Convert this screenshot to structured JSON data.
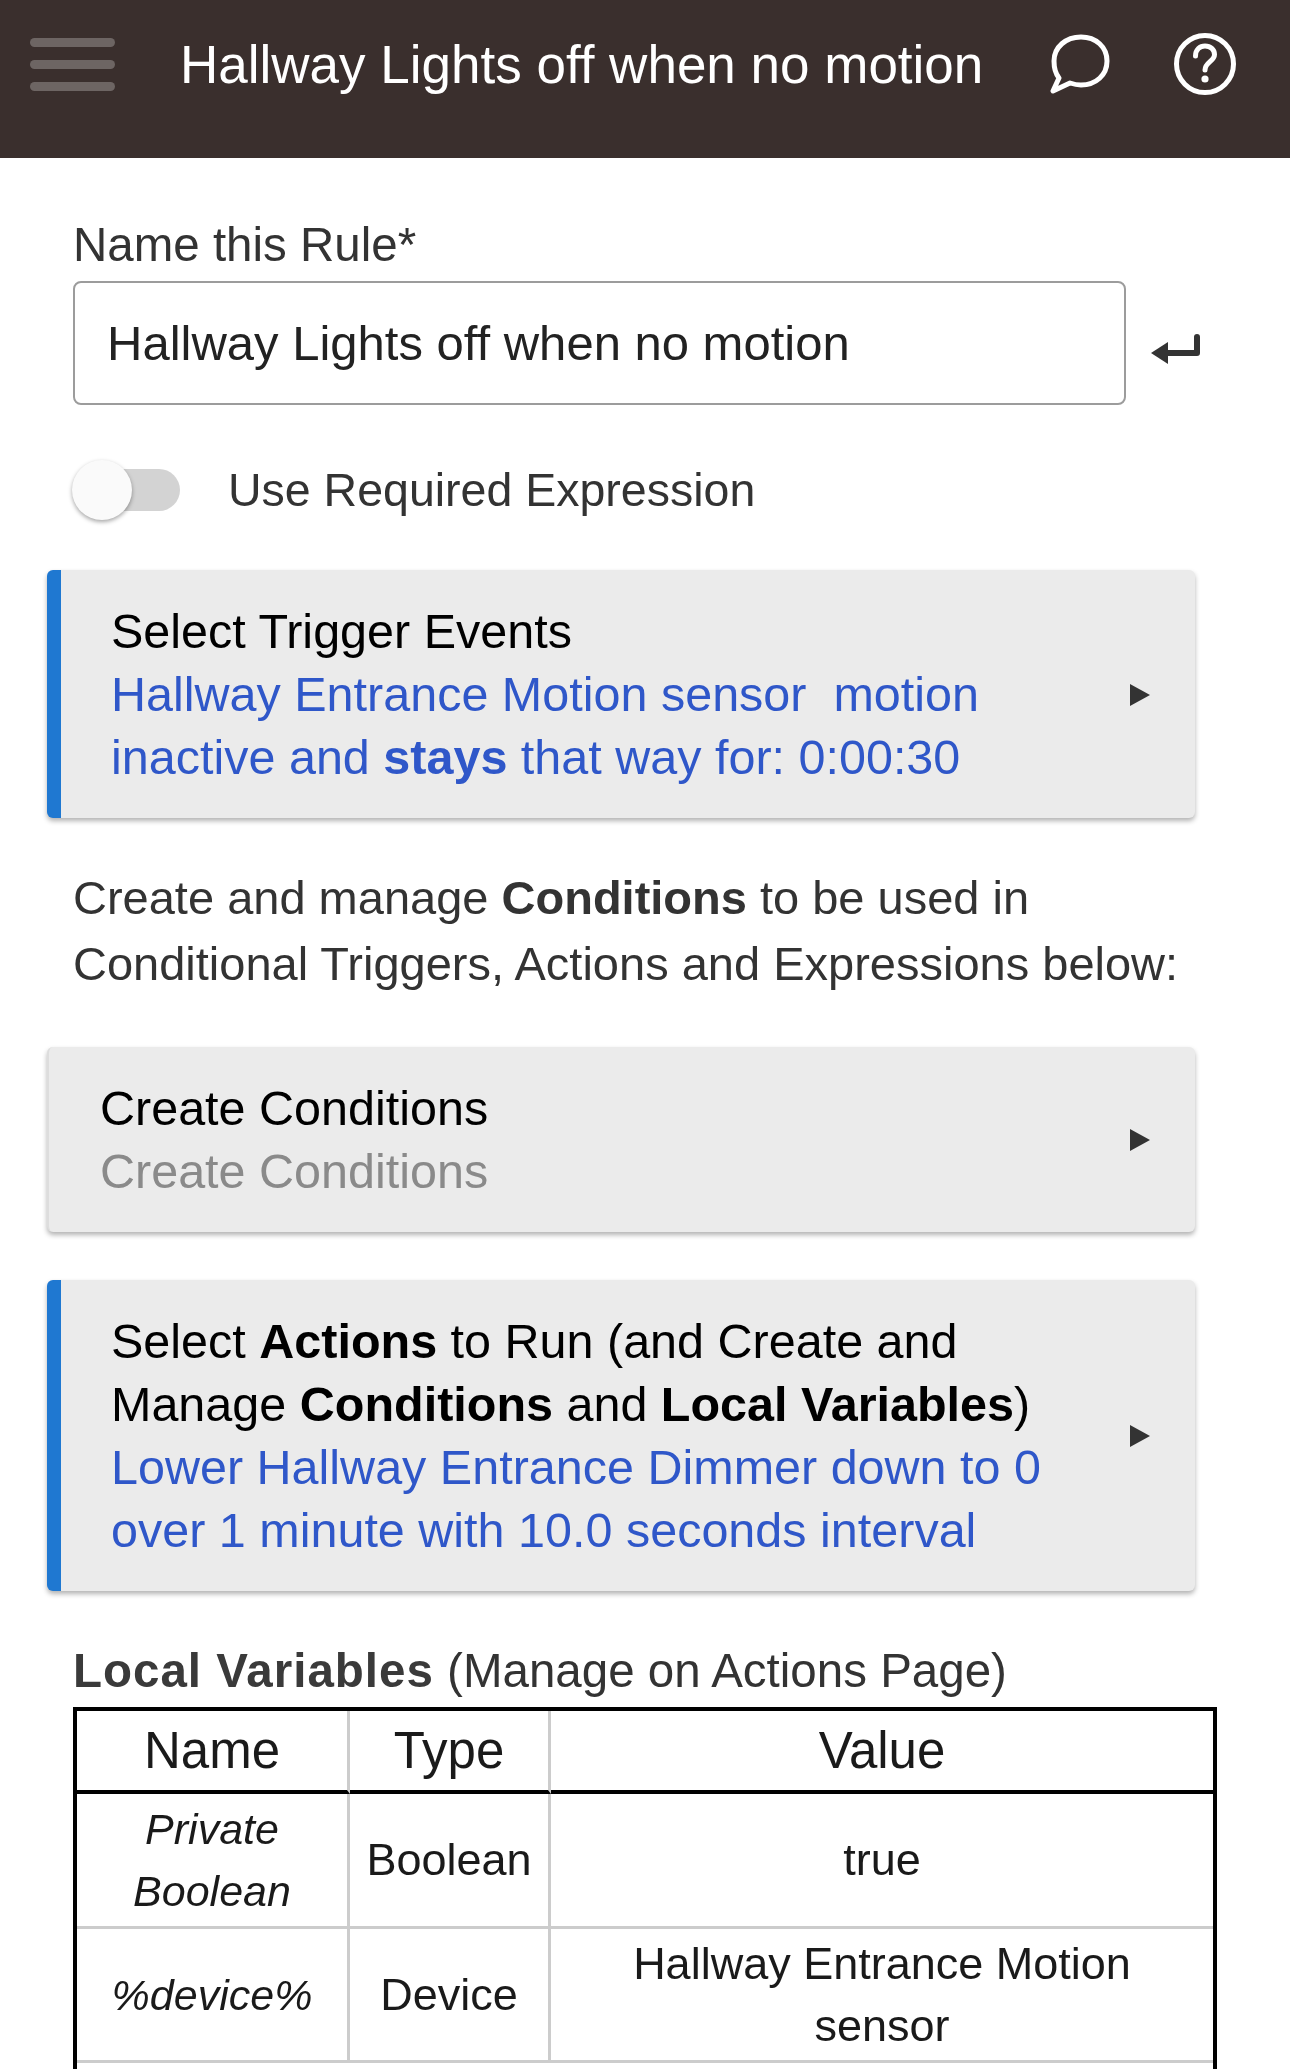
{
  "app_bar": {
    "title": "Hallway Lights off when no motion"
  },
  "name_field": {
    "label": "Name this Rule*",
    "value": "Hallway Lights off when no motion"
  },
  "required_expression_toggle": {
    "label": "Use Required Expression",
    "on": false
  },
  "sections": [
    {
      "kind": "card",
      "title": "Select Trigger Events",
      "summary": "Hallway Entrance Motion sensor  motion inactive and **stays** that way for: 0:00:30",
      "configured": true
    },
    {
      "kind": "text",
      "text": "Create and manage **Conditions** to be used in Conditional Triggers, Actions and Expressions below:"
    },
    {
      "kind": "card",
      "title": "Create Conditions",
      "summary": "Create Conditions",
      "configured": false
    },
    {
      "kind": "card",
      "title": "Select **Actions** to Run (and Create and Manage **Conditions** and **Local Variables**)",
      "summary": "Lower Hallway Entrance Dimmer down to 0 over 1 minute with 10.0 seconds interval",
      "configured": true
    }
  ],
  "local_variables": {
    "heading": "**Local Variables** (Manage on Actions Page)",
    "columns": [
      "Name",
      "Type",
      "Value"
    ],
    "rows": [
      {
        "name": "Private Boolean",
        "type": "Boolean",
        "value": "true"
      },
      {
        "name": "%device%",
        "type": "Device",
        "value": "Hallway Entrance Motion sensor"
      }
    ]
  }
}
